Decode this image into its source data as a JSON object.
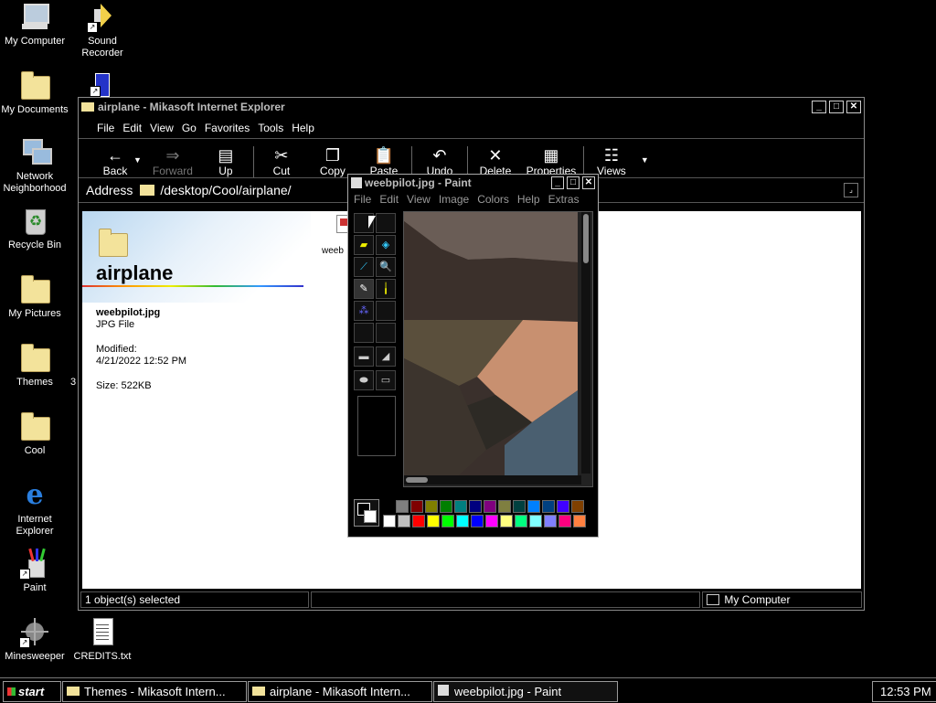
{
  "desktop": {
    "icons": [
      {
        "label": "My Computer"
      },
      {
        "label": "Sound Recorder"
      },
      {
        "label": "My Documents"
      },
      {
        "label": "Network Neighborhood"
      },
      {
        "label": "Recycle Bin"
      },
      {
        "label": "My Pictures"
      },
      {
        "label": "Themes"
      },
      {
        "label": "Cool"
      },
      {
        "label": "Internet Explorer"
      },
      {
        "label": "Paint"
      },
      {
        "label": "Minesweeper"
      },
      {
        "label": "CREDITS.txt"
      }
    ],
    "stray_char": "3"
  },
  "explorer": {
    "title": "airplane - Mikasoft Internet Explorer",
    "menu": [
      "File",
      "Edit",
      "View",
      "Go",
      "Favorites",
      "Tools",
      "Help"
    ],
    "toolbar": {
      "back": "Back",
      "forward": "Forward",
      "up": "Up",
      "cut": "Cut",
      "copy": "Copy",
      "paste": "Paste",
      "undo": "Undo",
      "delete": "Delete",
      "properties": "Properties",
      "views": "Views"
    },
    "address_label": "Address",
    "address_value": "/desktop/Cool/airplane/",
    "folder_title": "airplane",
    "file_name": "weebpilot.jpg",
    "file_type": "JPG File",
    "modified_label": "Modified:",
    "modified_value": "4/21/2022 12:52 PM",
    "size_label": "Size: 522KB",
    "file_icon_label": "weeb",
    "status_left": "1 object(s) selected",
    "status_right": "My Computer"
  },
  "paint": {
    "title": "weebpilot.jpg - Paint",
    "menu": [
      "File",
      "Edit",
      "View",
      "Image",
      "Colors",
      "Help",
      "Extras"
    ],
    "palette_top": [
      "#7f7f7f",
      "#7f0000",
      "#7f7f00",
      "#007f00",
      "#007f7f",
      "#00007f",
      "#7f007f",
      "#7f7f40",
      "#004040",
      "#0080ff",
      "#004080",
      "#4000ff",
      "#804000"
    ],
    "palette_bottom": [
      "#ffffff",
      "#c0c0c0",
      "#ff0000",
      "#ffff00",
      "#00ff00",
      "#00ffff",
      "#0000ff",
      "#ff00ff",
      "#ffff80",
      "#00ff80",
      "#80ffff",
      "#8080ff",
      "#ff0080",
      "#ff8040"
    ]
  },
  "taskbar": {
    "start": "start",
    "tasks": [
      "Themes - Mikasoft Intern...",
      "airplane - Mikasoft Intern...",
      "weebpilot.jpg - Paint"
    ],
    "clock": "12:53 PM"
  }
}
